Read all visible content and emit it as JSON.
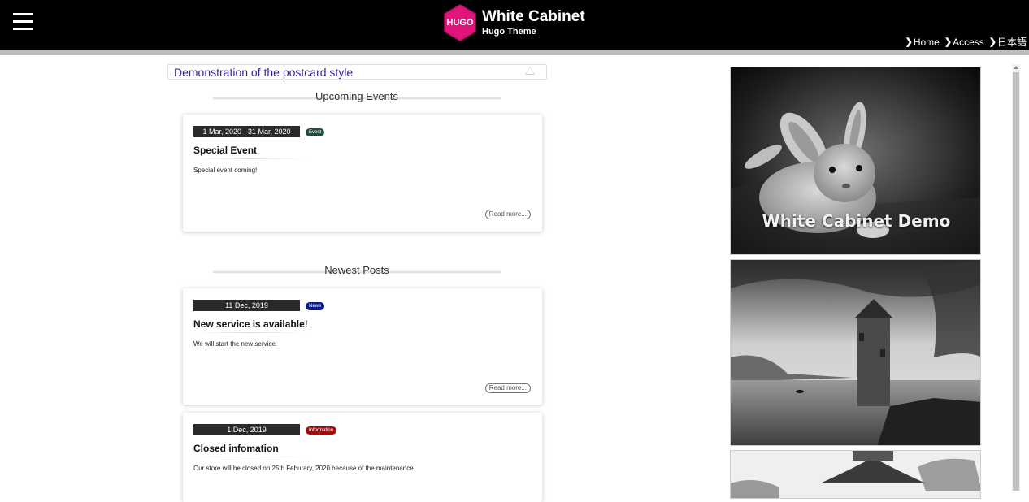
{
  "header": {
    "logo_text": "HUGO",
    "title": "White Cabinet",
    "subtitle": "Hugo Theme",
    "nav": [
      {
        "label": "Home"
      },
      {
        "label": "Access"
      },
      {
        "label": "日本語"
      }
    ]
  },
  "notice": {
    "text": "Demonstration of the postcard style"
  },
  "sections": {
    "upcoming": "Upcoming Events",
    "newest": "Newest Posts"
  },
  "cards": [
    {
      "date": "1 Mar, 2020 - 31 Mar, 2020",
      "badge": "Event",
      "badge_color": "#1f4d40",
      "title": "Special Event",
      "text": "Special event coming!",
      "read_more": "Read more..."
    },
    {
      "date": "11 Dec, 2019",
      "badge": "News",
      "badge_color": "#0a1a8a",
      "title": "New service is available!",
      "text": "We will start the new service.",
      "read_more": "Read more..."
    },
    {
      "date": "1 Dec, 2019",
      "badge": "Information",
      "badge_color": "#a10d0d",
      "title": "Closed infomation",
      "text": "Our store will be closed on 25th Feburary, 2020 because of the maintenance."
    }
  ],
  "sidebar": {
    "banner_caption": "White Cabinet Demo"
  },
  "colors": {
    "header_bg": "#000000",
    "logo_pink": "#e0157b",
    "notice_text": "#3b1f9c"
  }
}
